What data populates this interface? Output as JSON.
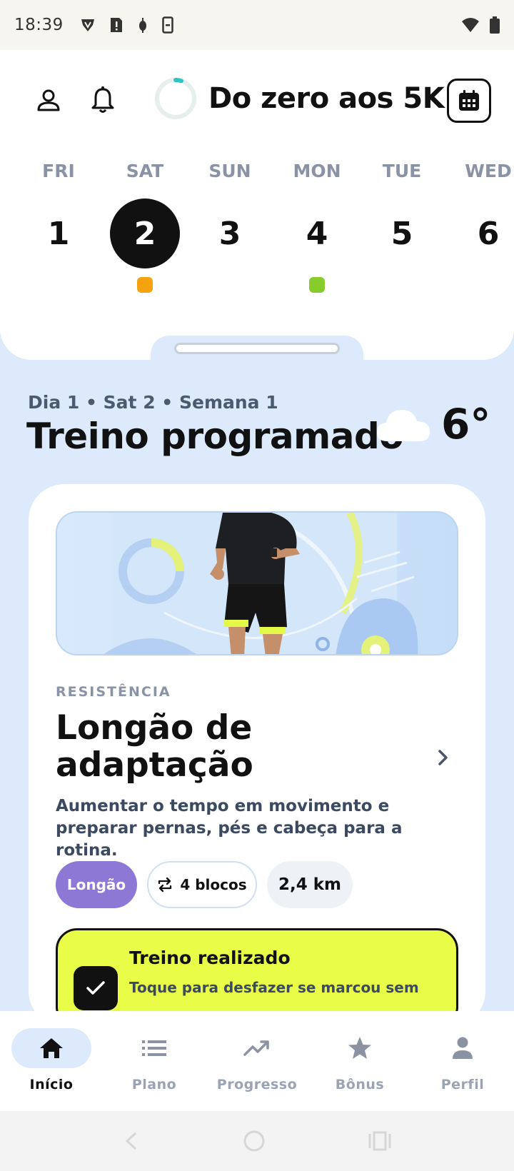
{
  "status_bar": {
    "time": "18:39"
  },
  "header": {
    "title": "Do zero aos 5K",
    "progress_fraction": 0.05
  },
  "week": [
    {
      "name": "FRI",
      "num": "1",
      "selected": false,
      "dot": null
    },
    {
      "name": "SAT",
      "num": "2",
      "selected": true,
      "dot": "#f5a20f"
    },
    {
      "name": "SUN",
      "num": "3",
      "selected": false,
      "dot": null
    },
    {
      "name": "MON",
      "num": "4",
      "selected": false,
      "dot": "#88cc2c"
    },
    {
      "name": "TUE",
      "num": "5",
      "selected": false,
      "dot": null
    },
    {
      "name": "WED",
      "num": "6",
      "selected": false,
      "dot": null
    }
  ],
  "section": {
    "meta": "Dia 1 • Sat 2 • Semana 1",
    "title": "Treino programado",
    "temperature": "6°",
    "weather_icon": "cloud-icon"
  },
  "card": {
    "category": "RESISTÊNCIA",
    "title": "Longão de adaptação",
    "description": "Aumentar o tempo em movimento e preparar pernas, pés e cabeça para a rotina.",
    "chip_type": "Longão",
    "chip_blocks": "4 blocos",
    "chip_distance": "2,4 km",
    "done_title": "Treino realizado",
    "done_subtitle": "Toque para desfazer se marcou sem"
  },
  "nav": [
    {
      "label": "Início",
      "icon": "home-icon",
      "active": true
    },
    {
      "label": "Plano",
      "icon": "list-icon",
      "active": false
    },
    {
      "label": "Progresso",
      "icon": "trend-icon",
      "active": false
    },
    {
      "label": "Bônus",
      "icon": "star-icon",
      "active": false
    },
    {
      "label": "Perfil",
      "icon": "person-icon",
      "active": false
    }
  ],
  "colors": {
    "accent_lime": "#e8fc48",
    "accent_purple": "#8e78d6",
    "background": "#dceafc",
    "ring_teal": "#2cc4c4"
  }
}
